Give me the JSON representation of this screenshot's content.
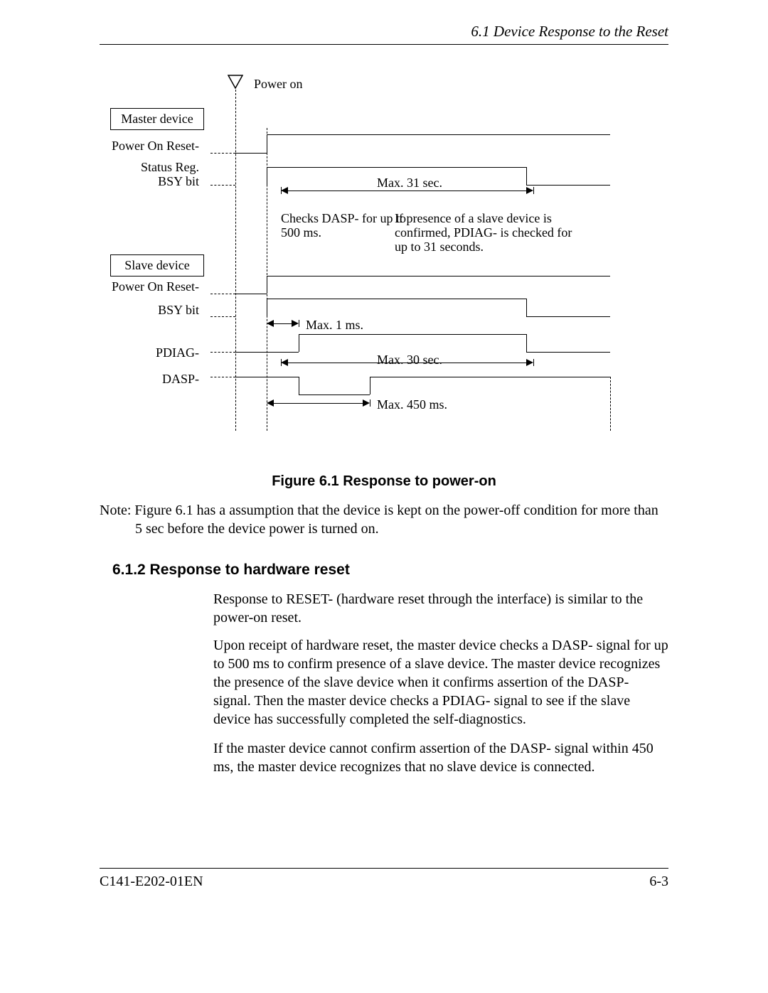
{
  "header": {
    "section_title": "6.1  Device Response to the Reset"
  },
  "diagram": {
    "power_on": "Power on",
    "master_box": "Master device",
    "slave_box": "Slave device",
    "master_labels": {
      "por": "Power On Reset-",
      "status1": "Status Reg.",
      "status2": "BSY bit"
    },
    "slave_labels": {
      "por": "Power On Reset-",
      "bsy": "BSY bit",
      "pdiag": "PDIAG-",
      "dasp": "DASP-"
    },
    "times": {
      "max31": "Max. 31 sec.",
      "checks1": "Checks DASP- for up to",
      "checks2": "500 ms.",
      "if1": "If presence of a slave device is",
      "if2": "confirmed, PDIAG- is checked for",
      "if3": "up to 31 seconds.",
      "max1": "Max. 1 ms.",
      "max30": "Max. 30 sec.",
      "max450": "Max. 450 ms."
    }
  },
  "figure_caption": "Figure 6.1  Response to power-on",
  "note_line1": "Note: Figure 6.1 has a assumption that the device is kept on the power-off condition for more than",
  "note_line2": "5 sec before the device power is turned on.",
  "section_heading": "6.1.2  Response to hardware reset",
  "para1": "Response to RESET- (hardware reset through the interface) is similar to the power-on reset.",
  "para2": "Upon receipt of hardware reset, the master device checks a DASP- signal for up to 500 ms to confirm presence of a slave device. The master device recognizes the presence of the slave device when it confirms assertion of the DASP- signal. Then the master device checks a PDIAG- signal to see if the slave device has successfully completed the self-diagnostics.",
  "para3": "If the master device cannot confirm assertion of the DASP- signal within 450 ms, the master device recognizes that no slave device is connected.",
  "footer": {
    "doc_id": "C141-E202-01EN",
    "page_no": "6-3"
  }
}
